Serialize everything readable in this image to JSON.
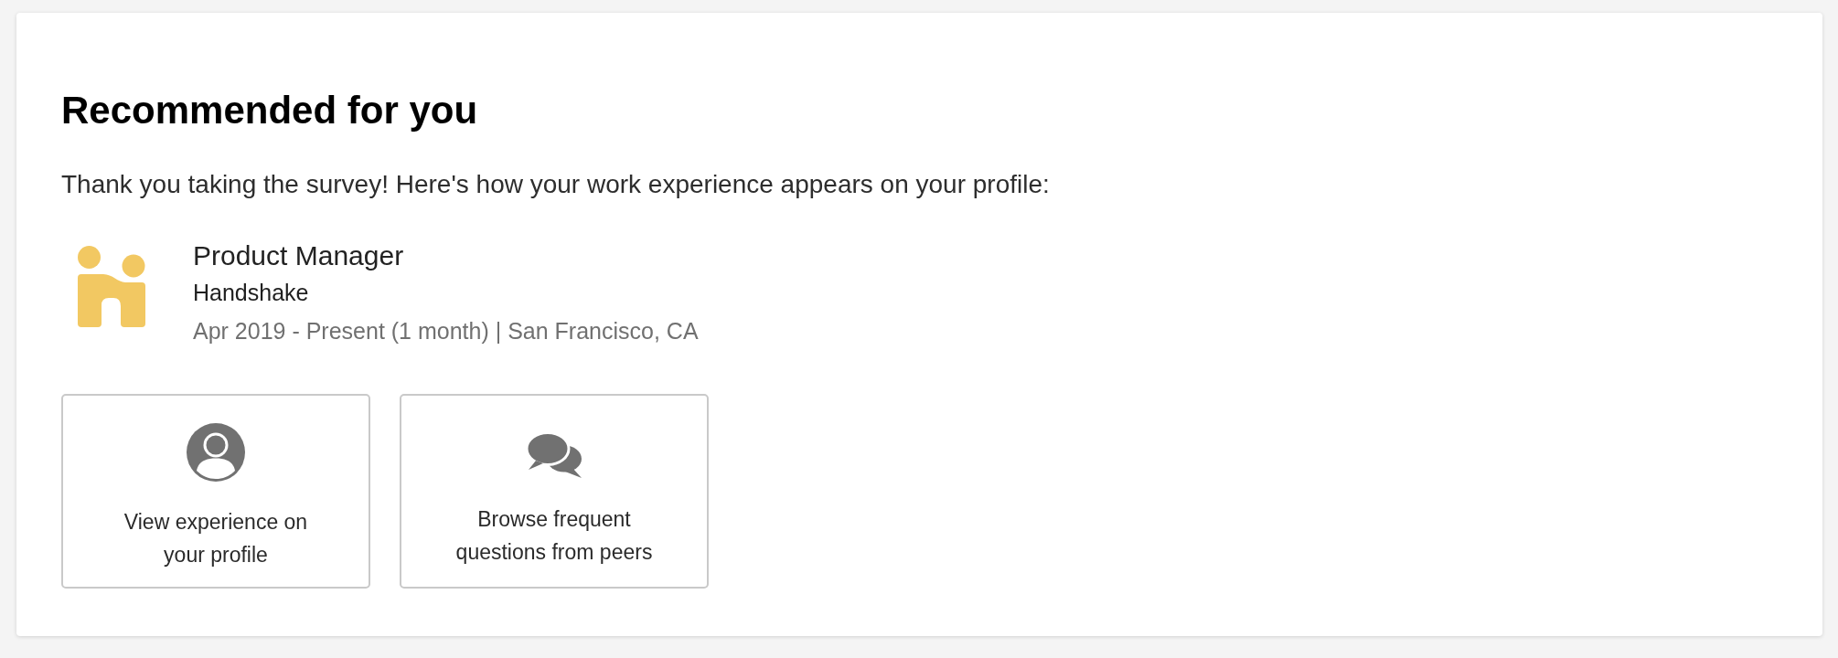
{
  "section": {
    "title": "Recommended for you",
    "message": "Thank you taking the survey! Here's how your work experience appears on your profile:"
  },
  "experience": {
    "title": "Product Manager",
    "company": "Handshake",
    "details": "Apr 2019 - Present (1 month) | San Francisco, CA"
  },
  "actions": [
    {
      "kind": "profile",
      "label": "View experience on your profile"
    },
    {
      "kind": "questions",
      "label": "Browse frequent questions from peers"
    }
  ]
}
